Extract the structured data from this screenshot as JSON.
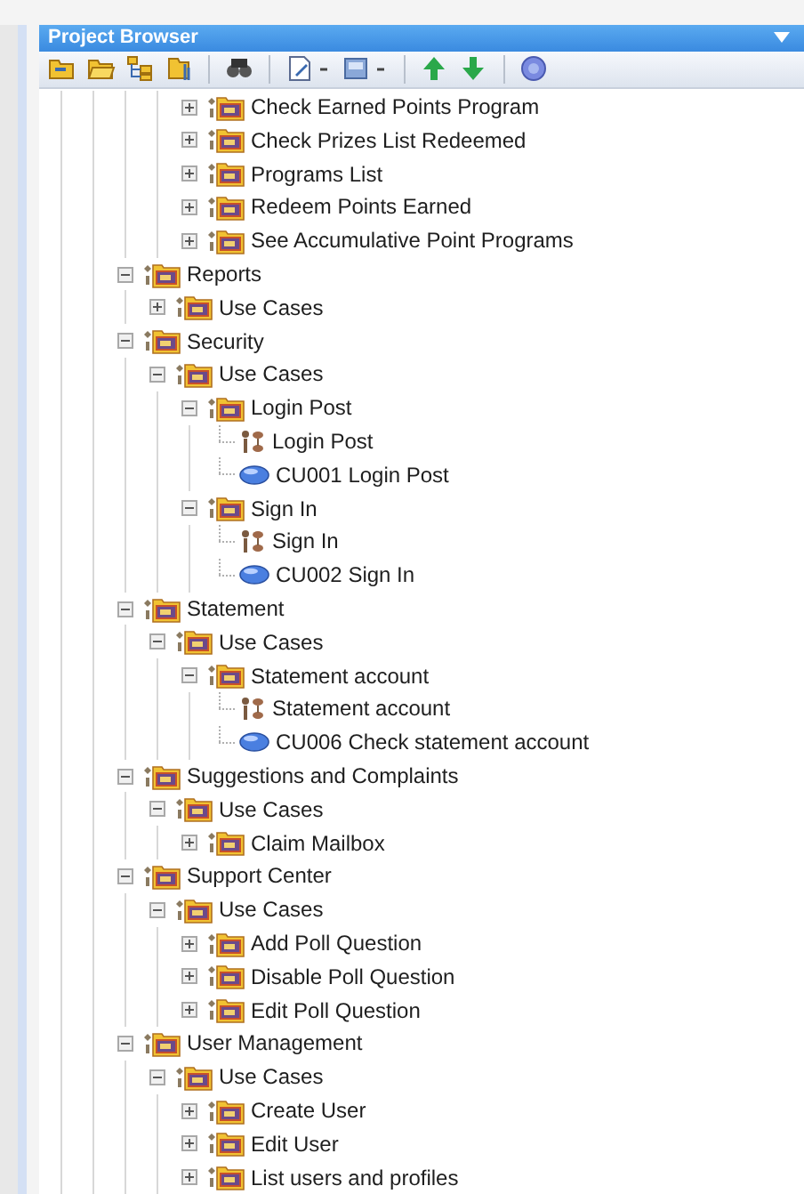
{
  "panel": {
    "title": "Project Browser"
  },
  "toolbar": [
    {
      "kind": "folder-new",
      "dropdown": false
    },
    {
      "kind": "folder-open",
      "dropdown": false
    },
    {
      "kind": "folder-tree",
      "dropdown": false
    },
    {
      "kind": "folder-list",
      "dropdown": false
    },
    {
      "kind": "find",
      "dropdown": false
    },
    {
      "kind": "document",
      "dropdown": true
    },
    {
      "kind": "box",
      "dropdown": true
    },
    {
      "kind": "up",
      "dropdown": false
    },
    {
      "kind": "down",
      "dropdown": false
    },
    {
      "kind": "globe",
      "dropdown": false
    }
  ],
  "continued_items": [
    {
      "label": "Check Earned Points Program",
      "kind": "package",
      "expanded": false
    },
    {
      "label": "Check Prizes List Redeemed",
      "kind": "package",
      "expanded": false
    },
    {
      "label": "Programs List",
      "kind": "package",
      "expanded": false
    },
    {
      "label": "Redeem Points Earned",
      "kind": "package",
      "expanded": false
    },
    {
      "label": "See Accumulative Point Programs",
      "kind": "package",
      "expanded": false
    }
  ],
  "tree": [
    {
      "label": "Reports",
      "kind": "package",
      "expanded": true,
      "children": [
        {
          "label": "Use Cases",
          "kind": "package",
          "expanded": false
        }
      ]
    },
    {
      "label": "Security",
      "kind": "package",
      "expanded": true,
      "children": [
        {
          "label": "Use Cases",
          "kind": "package",
          "expanded": true,
          "children": [
            {
              "label": "Login Post",
              "kind": "package",
              "expanded": true,
              "children": [
                {
                  "label": "Login Post",
                  "kind": "actor"
                },
                {
                  "label": "CU001 Login Post",
                  "kind": "usecase"
                }
              ]
            },
            {
              "label": "Sign In",
              "kind": "package",
              "expanded": true,
              "children": [
                {
                  "label": "Sign In",
                  "kind": "actor"
                },
                {
                  "label": "CU002 Sign In",
                  "kind": "usecase"
                }
              ]
            }
          ]
        }
      ]
    },
    {
      "label": "Statement",
      "kind": "package",
      "expanded": true,
      "children": [
        {
          "label": "Use Cases",
          "kind": "package",
          "expanded": true,
          "children": [
            {
              "label": "Statement account",
              "kind": "package",
              "expanded": true,
              "children": [
                {
                  "label": "Statement account",
                  "kind": "actor"
                },
                {
                  "label": "CU006 Check statement account",
                  "kind": "usecase"
                }
              ]
            }
          ]
        }
      ]
    },
    {
      "label": "Suggestions and Complaints",
      "kind": "package",
      "expanded": true,
      "children": [
        {
          "label": "Use Cases",
          "kind": "package",
          "expanded": true,
          "children": [
            {
              "label": "Claim Mailbox",
              "kind": "package",
              "expanded": false
            }
          ]
        }
      ]
    },
    {
      "label": "Support Center",
      "kind": "package",
      "expanded": true,
      "children": [
        {
          "label": "Use Cases",
          "kind": "package",
          "expanded": true,
          "children": [
            {
              "label": "Add Poll Question",
              "kind": "package",
              "expanded": false
            },
            {
              "label": "Disable Poll Question",
              "kind": "package",
              "expanded": false
            },
            {
              "label": "Edit Poll Question",
              "kind": "package",
              "expanded": false
            }
          ]
        }
      ]
    },
    {
      "label": "User Management",
      "kind": "package",
      "expanded": true,
      "children": [
        {
          "label": "Use Cases",
          "kind": "package",
          "expanded": true,
          "children": [
            {
              "label": "Create User",
              "kind": "package",
              "expanded": false
            },
            {
              "label": "Edit User",
              "kind": "package",
              "expanded": false
            },
            {
              "label": "List users and profiles",
              "kind": "package",
              "expanded": false
            }
          ]
        }
      ]
    }
  ]
}
